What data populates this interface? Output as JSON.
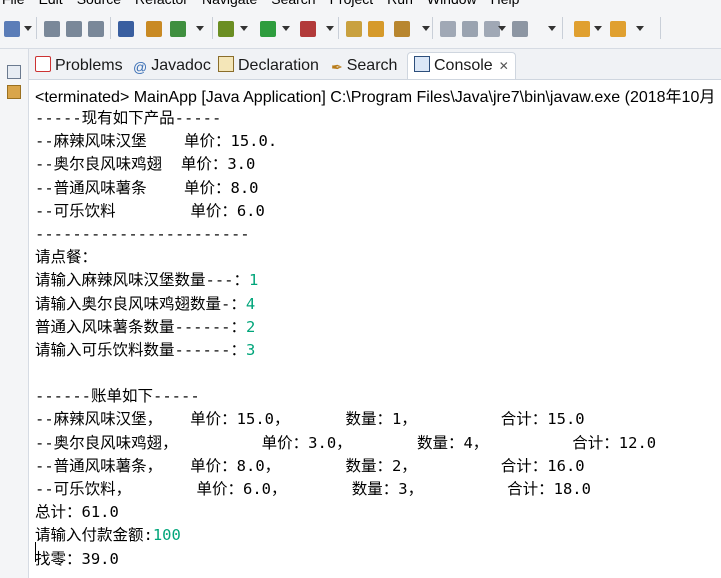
{
  "menubar": {
    "items": [
      "File",
      "Edit",
      "Source",
      "Refactor",
      "Navigate",
      "Search",
      "Project",
      "Run",
      "Window",
      "Help"
    ]
  },
  "toolbar": {
    "icons": [
      "new-icon",
      "save-icon",
      "save-all-icon",
      "print-icon",
      "toggle-breakpoint-icon",
      "new-java-class-icon",
      "refresh-icon",
      "debug-icon",
      "run-icon",
      "external-tools-icon",
      "open-type-icon",
      "open-task-icon",
      "pen-icon",
      "edit-icon",
      "annotation-icon",
      "next-annotation-icon",
      "previous-annotation-icon",
      "back-icon",
      "forward-icon"
    ]
  },
  "tabs": [
    {
      "label": "Problems",
      "icon": "problems-icon"
    },
    {
      "label": "Javadoc",
      "icon": "javadoc-icon"
    },
    {
      "label": "Declaration",
      "icon": "declaration-icon"
    },
    {
      "label": "Search",
      "icon": "search-icon"
    },
    {
      "label": "Console",
      "icon": "console-icon",
      "active": true
    }
  ],
  "console": {
    "status": "<terminated> MainApp [Java Application] C:\\Program Files\\Java\\jre7\\bin\\javaw.exe (2018年10月",
    "lines": [
      {
        "text": "-----现有如下产品-----"
      },
      {
        "text": "--麻辣风味汉堡    单价：15.0."
      },
      {
        "text": "--奥尔良风味鸡翅  单价：3.0"
      },
      {
        "text": "--普通风味薯条    单价：8.0"
      },
      {
        "text": "--可乐饮料        单价：6.0"
      },
      {
        "text": "-----------------------"
      },
      {
        "text": "请点餐："
      },
      {
        "text": "请输入麻辣风味汉堡数量---：",
        "input": "1"
      },
      {
        "text": "请输入奥尔良风味鸡翅数量-：",
        "input": "4"
      },
      {
        "text": "普通入风味薯条数量------：",
        "input": "2"
      },
      {
        "text": "请输入可乐饮料数量------：",
        "input": "3"
      },
      {
        "text": ""
      },
      {
        "text": "------账单如下-----"
      },
      {
        "text": "--麻辣风味汉堡，   单价：15.0，      数量：1，         合计：15.0"
      },
      {
        "text": "--奥尔良风味鸡翅，         单价：3.0，       数量：4，         合计：12.0"
      },
      {
        "text": "--普通风味薯条，   单价：8.0，       数量：2，         合计：16.0"
      },
      {
        "text": "--可乐饮料，       单价：6.0，       数量：3，         合计：18.0"
      },
      {
        "text": "总计：61.0"
      },
      {
        "text": "请输入付款金额:",
        "input": "100"
      },
      {
        "text": "找零：39.0"
      }
    ],
    "input_color": "#00a57a"
  }
}
